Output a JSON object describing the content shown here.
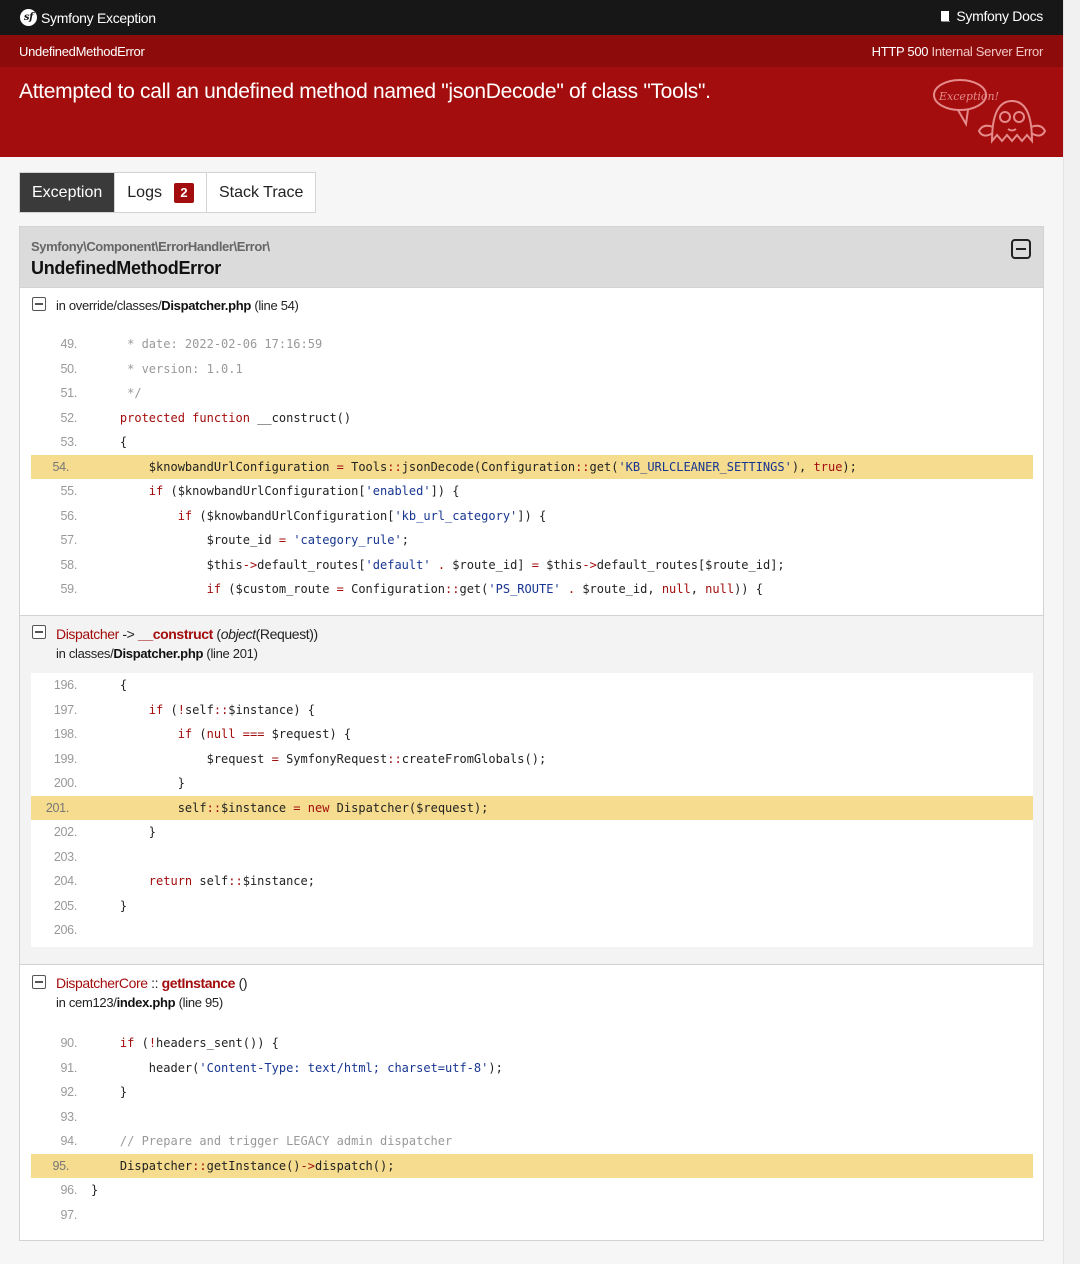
{
  "topbar": {
    "brand": "Symfony Exception",
    "docs": "Symfony Docs"
  },
  "subbar": {
    "exception_class": "UndefinedMethodError",
    "http_code": "HTTP 500",
    "http_text": "Internal Server Error"
  },
  "header": {
    "message": "Attempted to call an undefined method named \"jsonDecode\" of class \"Tools\"."
  },
  "tabs": [
    {
      "label": "Exception",
      "active": true
    },
    {
      "label": "Logs",
      "badge": "2"
    },
    {
      "label": "Stack Trace"
    }
  ],
  "trace": {
    "namespace": "Symfony\\Component\\ErrorHandler\\Error\\",
    "class": "UndefinedMethodError",
    "sections": [
      {
        "location_prefix": "in override/classes/",
        "file": "Dispatcher.php",
        "line_info": "(line 54)",
        "lines": [
          {
            "n": "49.",
            "code": "     * date: 2022-02-06 17:16:59"
          },
          {
            "n": "50.",
            "code": "     * version: 1.0.1"
          },
          {
            "n": "51.",
            "code": "     */"
          },
          {
            "n": "52.",
            "code": "    protected function __construct()"
          },
          {
            "n": "53.",
            "code": "    {"
          },
          {
            "n": "54.",
            "code": "        $knowbandUrlConfiguration = Tools::jsonDecode(Configuration::get('KB_URLCLEANER_SETTINGS'), true);",
            "hl": true
          },
          {
            "n": "55.",
            "code": "        if ($knowbandUrlConfiguration['enabled']) {"
          },
          {
            "n": "56.",
            "code": "            if ($knowbandUrlConfiguration['kb_url_category']) {"
          },
          {
            "n": "57.",
            "code": "                $route_id = 'category_rule';"
          },
          {
            "n": "58.",
            "code": "                $this->default_routes['default' . $route_id] = $this->default_routes[$route_id];"
          },
          {
            "n": "59.",
            "code": "                if ($custom_route = Configuration::get('PS_ROUTE' . $route_id, null, null)) {"
          }
        ]
      },
      {
        "call_class": "Dispatcher",
        "call_op": "->",
        "call_method": "__construct",
        "call_args_type": "object",
        "call_args_value": "(Request)",
        "location_prefix": "in classes/",
        "file": "Dispatcher.php",
        "line_info": "(line 201)",
        "lines": [
          {
            "n": "196.",
            "code": "    {"
          },
          {
            "n": "197.",
            "code": "        if (!self::$instance) {"
          },
          {
            "n": "198.",
            "code": "            if (null === $request) {"
          },
          {
            "n": "199.",
            "code": "                $request = SymfonyRequest::createFromGlobals();"
          },
          {
            "n": "200.",
            "code": "            }"
          },
          {
            "n": "201.",
            "code": "            self::$instance = new Dispatcher($request);",
            "hl": true
          },
          {
            "n": "202.",
            "code": "        }"
          },
          {
            "n": "203.",
            "code": ""
          },
          {
            "n": "204.",
            "code": "        return self::$instance;"
          },
          {
            "n": "205.",
            "code": "    }"
          },
          {
            "n": "206.",
            "code": ""
          }
        ]
      },
      {
        "call_class": "DispatcherCore",
        "call_op": "::",
        "call_method": "getInstance",
        "call_args": "()",
        "location_prefix": "in cem123/",
        "file": "index.php",
        "line_info": "(line 95)",
        "lines": [
          {
            "n": "90.",
            "code": "    if (!headers_sent()) {"
          },
          {
            "n": "91.",
            "code": "        header('Content-Type: text/html; charset=utf-8');"
          },
          {
            "n": "92.",
            "code": "    }"
          },
          {
            "n": "93.",
            "code": ""
          },
          {
            "n": "94.",
            "code": "    // Prepare and trigger LEGACY admin dispatcher"
          },
          {
            "n": "95.",
            "code": "    Dispatcher::getInstance()->dispatch();",
            "hl": true
          },
          {
            "n": "96.",
            "code": "}"
          },
          {
            "n": "97.",
            "code": ""
          }
        ]
      }
    ]
  },
  "colors": {
    "topbar": "#171717",
    "subbar": "#8d0b0b",
    "header": "#a30d0d",
    "highlight": "#f5dc8e"
  }
}
